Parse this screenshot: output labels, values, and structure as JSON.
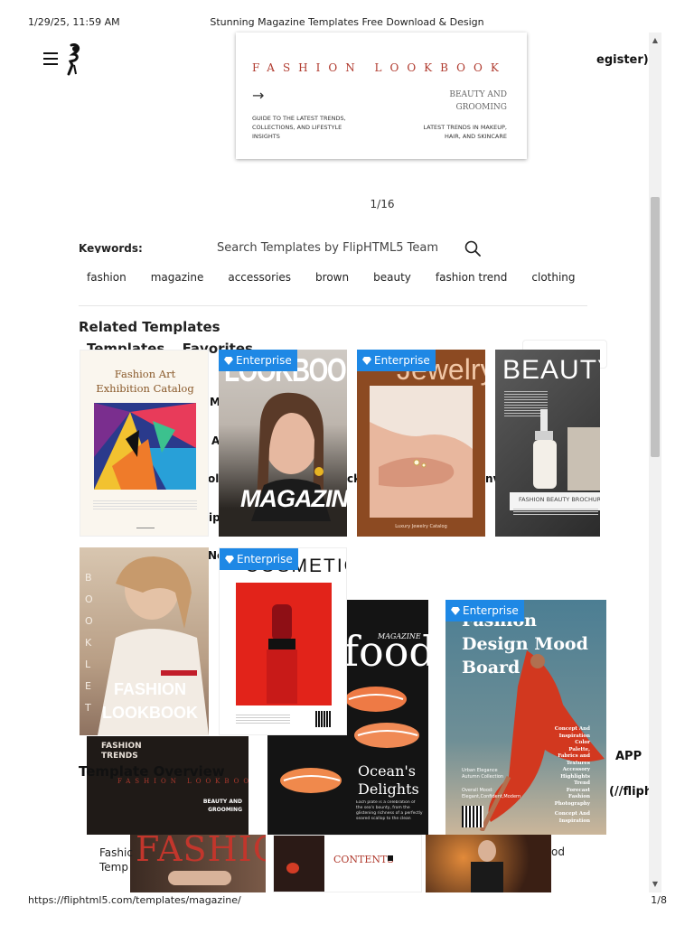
{
  "print": {
    "date": "1/29/25, 11:59 AM",
    "title": "Stunning Magazine Templates Free Download & Design",
    "url": "https://fliphtml5.com/templates/magazine/",
    "page": "1/8"
  },
  "header": {
    "register_fragment": "egister)"
  },
  "preview": {
    "title": "FASHION LOOKBOOK",
    "right_heading": "BEAUTY AND GROOMING",
    "left_text": "GUIDE TO THE LATEST TRENDS, COLLECTIONS, AND LIFESTYLE INSIGHTS",
    "right_text": "LATEST TRENDS IN MAKEUP, HAIR, AND SKINCARE",
    "arrow": "→",
    "pager": "1/16"
  },
  "search": {
    "keywords_label": "Keywords:",
    "placeholder": "Search Templates by FlipHTML5 Team",
    "tags": [
      "fashion",
      "magazine",
      "accessories",
      "brown",
      "beauty",
      "fashion trend",
      "clothing"
    ]
  },
  "related": {
    "heading": "Related Templates",
    "tabs": [
      "Templates",
      "Favorites"
    ],
    "badge_label": "Enterprise",
    "cards": {
      "art": {
        "title": "Fashion Art Exhibition Catalog"
      },
      "lookbook_mag": {
        "top": "LOOKBOOK",
        "bottom": "MAGAZINE"
      },
      "jewelry": {
        "title": "Jewelry",
        "footer": "Luxury Jewelry Catalog"
      },
      "beauty": {
        "title": "BEAUTY",
        "band": "FASHION BEAUTY BROCHURE"
      },
      "booklet": {
        "side": "BOOKLET",
        "title": "FASHION LOOKBOOK"
      },
      "cosmetic": {
        "title": "COSMETIC"
      },
      "food": {
        "script": "MAGAZINE",
        "title": "food",
        "sub": "Ocean's Delights",
        "desc": "Each plate is a celebration of the sea's bounty, from the glistening richness of a perfectly seared scallop to the clean"
      },
      "trends": {
        "label": "FASHION TRENDS",
        "mini_title": "FASHION LOOKBOOK",
        "mini_right": "BEAUTY AND GROOMING"
      },
      "mood": {
        "title": "Fashion Design Mood Board",
        "right_text": "Concept And Inspiration Color Palette, Fabrics and Textures Accessory Highlights Trend Forecast Fashion Photography",
        "bottom_right": "Concept And Inspiration",
        "left_text": "Urban Elegance Autumn Collection",
        "overall": "Overall Mood: Elegant,Confident,Modern"
      },
      "fashion_bottom": {
        "title": "FASHION"
      },
      "contents": {
        "title": "CONTENTS"
      }
    }
  },
  "overview": {
    "heading": "Template Overview",
    "app": "APP",
    "link_fragment": "(//flipht",
    "bottom_text_1": "Fashic",
    "bottom_text_2": "Temp",
    "od": "od"
  },
  "ghost_letters": [
    "M",
    "A",
    "ol",
    "ck",
    "nv",
    "ip",
    "Ne"
  ]
}
